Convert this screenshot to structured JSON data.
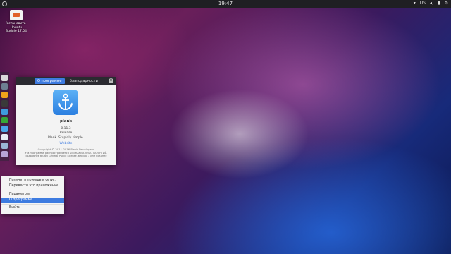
{
  "panel": {
    "time": "19:47",
    "keyboard_layout": "US",
    "tray_icons": [
      "network-icon",
      "volume-icon",
      "battery-icon",
      "settings-icon"
    ]
  },
  "desktop": {
    "install_icon_label": "Установить\nUbuntu\nBudgie 17.04"
  },
  "dock": {
    "items": [
      {
        "name": "dock-chromium",
        "color": "#d9d9d9"
      },
      {
        "name": "dock-files",
        "color": "#6e7f92"
      },
      {
        "name": "dock-rhythmbox",
        "color": "#f0a31a"
      },
      {
        "name": "dock-music",
        "color": "#3a3a3a"
      },
      {
        "name": "dock-libreoffice",
        "color": "#3f9cdc"
      },
      {
        "name": "dock-calc",
        "color": "#37a836"
      },
      {
        "name": "dock-software",
        "color": "#4aa6e9"
      },
      {
        "name": "dock-terminal",
        "color": "#e8eef6"
      },
      {
        "name": "dock-settings",
        "color": "#9bb5d6"
      },
      {
        "name": "dock-plank",
        "color": "#b8a3d6"
      }
    ]
  },
  "about_window": {
    "tabs": [
      "О программе",
      "Благодарности"
    ],
    "app_name": "plank",
    "version": "0.11.3",
    "release": "Release",
    "description": "Plank. Stupidly simple.",
    "website": "Website",
    "copyright": "Copyright © 2011-2016 Plank Developers",
    "license_line1": "Эта программа распространяется БЕЗ КАКИХ-ЛИБО ГАРАНТИЙ.",
    "license_line2": "Подробнее в GNU General Public License, версии 3 или позднее",
    "close_label": "×"
  },
  "context_menu": {
    "items": [
      "Получить помощь в сети...",
      "Перевести это приложение...",
      "Параметры",
      "О программе",
      "Выйти"
    ],
    "selected": "О программе"
  }
}
